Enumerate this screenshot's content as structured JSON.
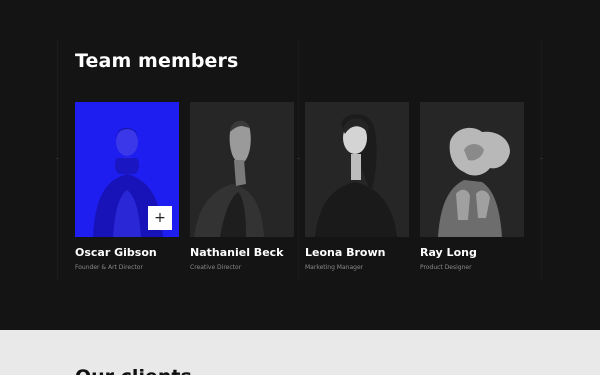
{
  "team": {
    "title": "Team members",
    "add_symbol": "+",
    "members": [
      {
        "name": "Oscar Gibson",
        "role": "Founder & Art Director",
        "highlighted": true
      },
      {
        "name": "Nathaniel Beck",
        "role": "Creative Director",
        "highlighted": false
      },
      {
        "name": "Leona Brown",
        "role": "Marketing Manager",
        "highlighted": false
      },
      {
        "name": "Ray Long",
        "role": "Product Designer",
        "highlighted": false
      }
    ]
  },
  "clients": {
    "title": "Our clients"
  },
  "colors": {
    "background": "#141414",
    "accent": "#1f1ef0",
    "clients_background": "#e9e9e9"
  }
}
